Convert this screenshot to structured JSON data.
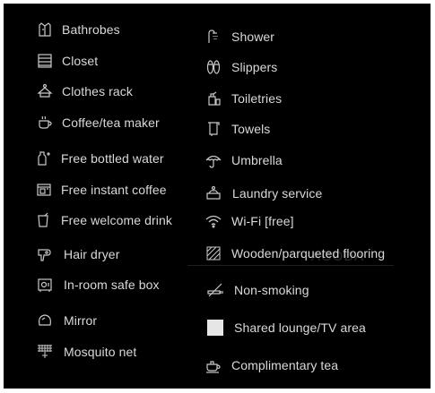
{
  "amenities": {
    "left": [
      {
        "label": "Bathrobes",
        "icon": "bathrobe-icon"
      },
      {
        "label": "Closet",
        "icon": "closet-icon"
      },
      {
        "label": "Clothes rack",
        "icon": "clothes-rack-icon"
      },
      {
        "label": "Coffee/tea maker",
        "icon": "coffee-cup-icon"
      },
      {
        "label": "Free bottled water",
        "icon": "water-bottle-icon"
      },
      {
        "label": "Free instant coffee",
        "icon": "coffee-machine-icon"
      },
      {
        "label": "Free welcome drink",
        "icon": "glass-icon"
      },
      {
        "label": "Hair dryer",
        "icon": "hair-dryer-icon"
      },
      {
        "label": "In-room safe box",
        "icon": "safe-icon"
      },
      {
        "label": "Mirror",
        "icon": "mirror-icon"
      },
      {
        "label": "Mosquito net",
        "icon": "mosquito-net-icon"
      }
    ],
    "right": [
      {
        "label": "Shower",
        "icon": "shower-icon"
      },
      {
        "label": "Slippers",
        "icon": "slippers-icon"
      },
      {
        "label": "Toiletries",
        "icon": "toiletries-icon"
      },
      {
        "label": "Towels",
        "icon": "towel-icon"
      },
      {
        "label": "Umbrella",
        "icon": "umbrella-icon"
      },
      {
        "label": "Laundry service",
        "icon": "laundry-icon"
      },
      {
        "label": "Wi-Fi [free]",
        "icon": "wifi-icon"
      },
      {
        "label": "Wooden/parqueted flooring",
        "icon": "flooring-icon"
      },
      {
        "label": "Non-smoking",
        "icon": "no-smoking-icon"
      },
      {
        "label": "Shared lounge/TV area",
        "icon": "lounge-swatch-icon"
      },
      {
        "label": "Complimentary tea",
        "icon": "teacup-icon"
      }
    ]
  },
  "watermark": "AGODA",
  "colors": {
    "background": "#000000",
    "text": "#d9d9d9",
    "icon": "#c8c8c8",
    "swatch": "#e6e6e6"
  }
}
